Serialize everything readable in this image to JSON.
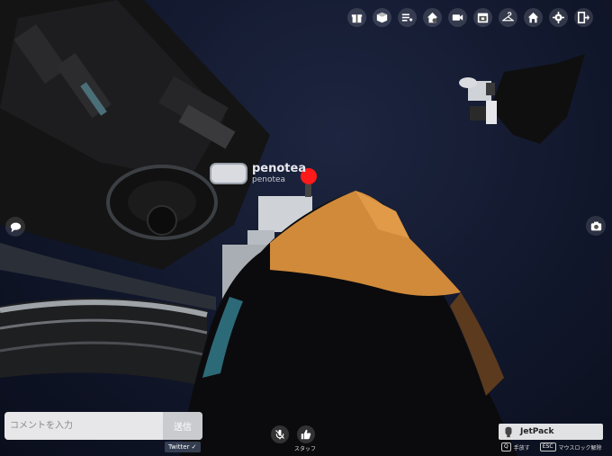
{
  "player": {
    "display_name": "penotea",
    "user_id": "penotea"
  },
  "toolbar": {
    "icons": [
      "gift-icon",
      "box-icon",
      "list-add-icon",
      "home-settings-icon",
      "camera-record-icon",
      "calendar-icon",
      "hanger-icon",
      "home-icon",
      "gear-icon",
      "exit-icon"
    ]
  },
  "comment": {
    "placeholder": "コメントを入力",
    "send_label": "送信",
    "twitter_label": "Twitter ✓"
  },
  "bottom": {
    "staff_label": "スタッフ"
  },
  "item_panel": {
    "name": "JetPack",
    "key1": "Q",
    "key1_label": "手放す",
    "key2": "ESC",
    "key2_label": "マウスロック解除"
  },
  "colors": {
    "sky": "#11172b",
    "marker": "#ff1a1a",
    "character": "#d18a3a"
  }
}
